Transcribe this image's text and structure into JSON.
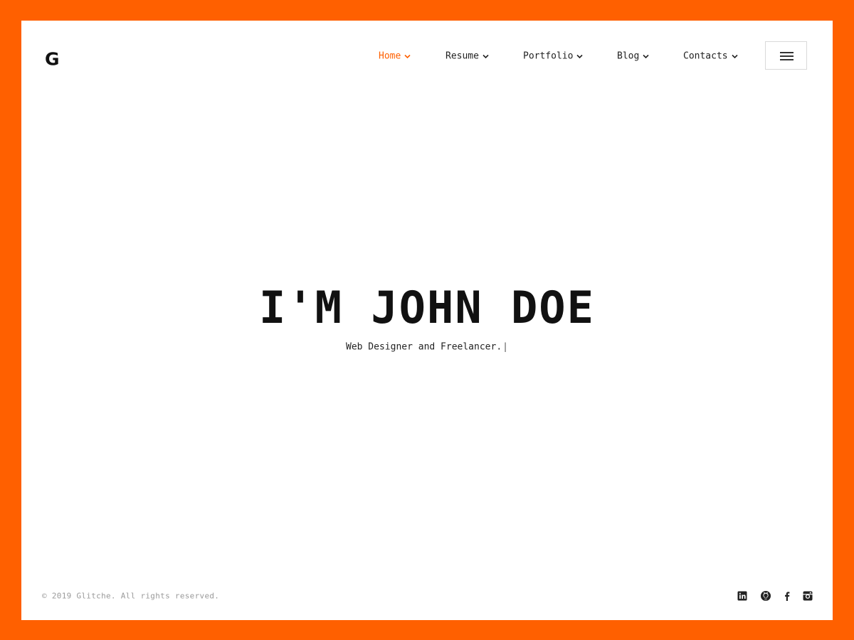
{
  "brand": {
    "logo": "G"
  },
  "nav": {
    "items": [
      {
        "label": "Home",
        "active": true
      },
      {
        "label": "Resume",
        "active": false
      },
      {
        "label": "Portfolio",
        "active": false
      },
      {
        "label": "Blog",
        "active": false
      },
      {
        "label": "Contacts",
        "active": false
      }
    ],
    "menu_icon": "hamburger-icon"
  },
  "hero": {
    "title": "I'M JOHN DOE",
    "subtitle": "Web Designer and Freelancer.",
    "cursor": "|"
  },
  "footer": {
    "copyright": "© 2019 Glitche. All rights reserved.",
    "social": [
      "linkedin-icon",
      "github-icon",
      "facebook-icon",
      "instagram-icon"
    ]
  },
  "colors": {
    "accent": "#ff6000",
    "frame": "#ff6000",
    "background": "#ffffff",
    "text": "#111111",
    "muted": "#9a9a9a"
  }
}
